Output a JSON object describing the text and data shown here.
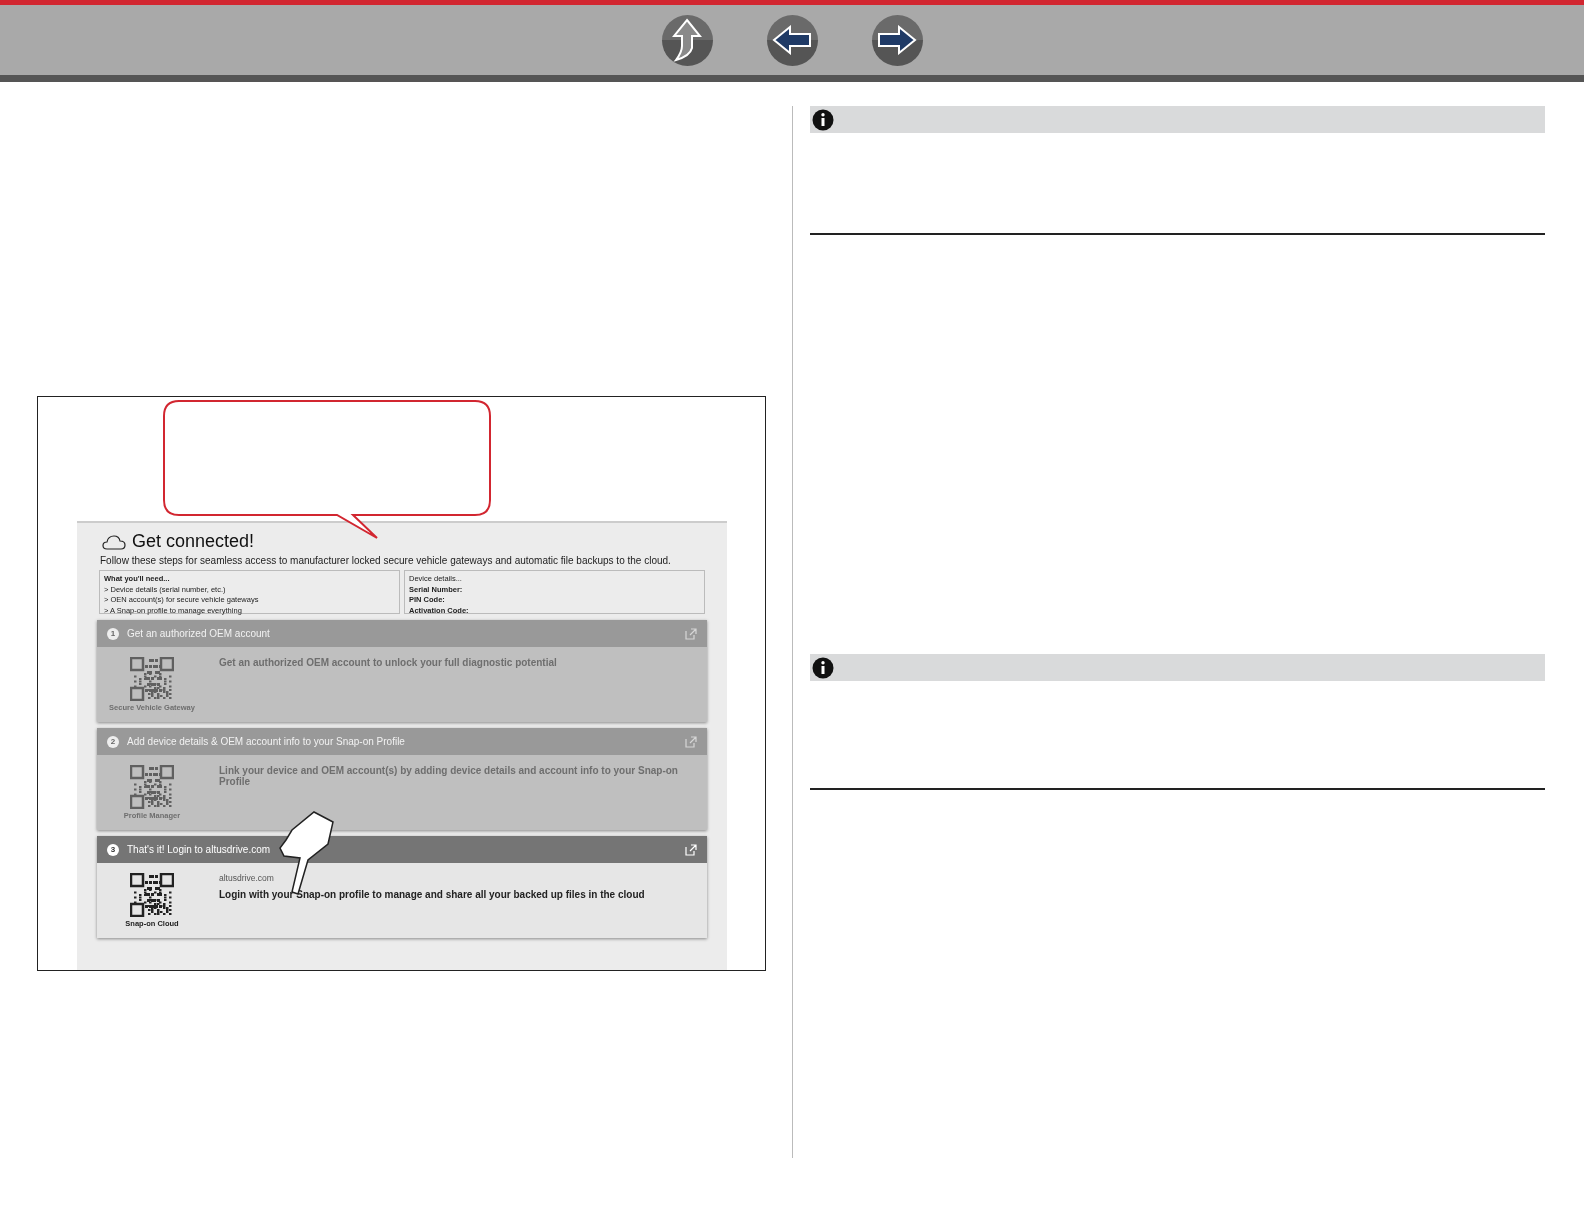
{
  "nav_buttons": [
    {
      "kind": "up"
    },
    {
      "kind": "back"
    },
    {
      "kind": "forward"
    }
  ],
  "screenshot": {
    "title": "Get connected!",
    "subtitle": "Follow these steps for seamless access to manufacturer locked secure vehicle gateways and automatic file backups to the cloud.",
    "needs": {
      "heading": "What you'll need...",
      "items": [
        "> Device details (serial number, etc.)",
        "> OEN account(s) for secure vehicle gateways",
        "> A Snap-on profile to manage everything"
      ]
    },
    "device": {
      "heading": "Device details...",
      "fields": [
        "Serial Number:",
        "PIN Code:",
        "Activation Code:"
      ]
    },
    "steps": [
      {
        "number": "1",
        "title": "Get an authorized OEM account",
        "qr_label": "Secure Vehicle Gateway",
        "description": "Get an authorized OEM account to unlock your full diagnostic potential",
        "disabled": true
      },
      {
        "number": "2",
        "title": "Add device details & OEM account info to your Snap-on Profile",
        "qr_label": "Profile Manager",
        "description": "Link your device and OEM account(s) by adding device details and account info to your Snap-on Profile",
        "disabled": true
      },
      {
        "number": "3",
        "title": "That's it! Login to altusdrive.com",
        "qr_label": "Snap-on Cloud",
        "url": "altusdrive.com",
        "description": "Login with your Snap-on profile to manage and share all your backed up files in the cloud",
        "disabled": false
      }
    ]
  }
}
